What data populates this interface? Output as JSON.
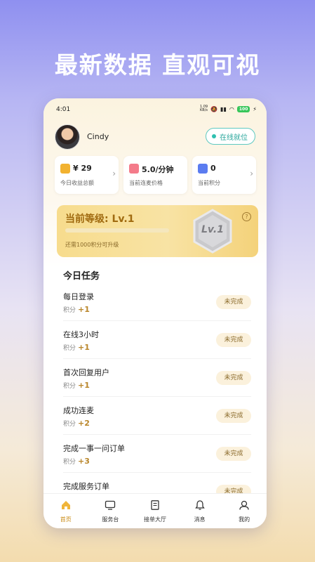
{
  "headline": "最新数据 直观可视",
  "status_bar": {
    "time": "4:01",
    "speed_value": "1.09",
    "speed_unit": "KB/s",
    "battery": "100"
  },
  "profile": {
    "name": "Cindy",
    "status": "在线就位"
  },
  "stats": [
    {
      "value": "¥ 29",
      "label": "今日收益总额",
      "icon": "money-bag-icon",
      "color": "#f2b230"
    },
    {
      "value": "5.0/分钟",
      "label": "当前连麦价格",
      "icon": "heart-hands-icon",
      "color": "#f47b8a"
    },
    {
      "value": "0",
      "label": "当前积分",
      "icon": "coins-stack-icon",
      "color": "#5b7cf0"
    }
  ],
  "level": {
    "title": "当前等级: Lv.1",
    "badge": "Lv.1",
    "hint": "还需1000积分可升级",
    "progress": 0
  },
  "tasks_title": "今日任务",
  "tasks": [
    {
      "name": "每日登录",
      "points_label": "积分",
      "points": "+1",
      "status": "未完成"
    },
    {
      "name": "在线3小时",
      "points_label": "积分",
      "points": "+1",
      "status": "未完成"
    },
    {
      "name": "首次回复用户",
      "points_label": "积分",
      "points": "+1",
      "status": "未完成"
    },
    {
      "name": "成功连麦",
      "points_label": "积分",
      "points": "+2",
      "status": "未完成"
    },
    {
      "name": "完成一事一问订单",
      "points_label": "积分",
      "points": "+3",
      "status": "未完成"
    },
    {
      "name": "完成服务订单",
      "points_label": "",
      "points": "",
      "status": "未完成"
    }
  ],
  "tabs": [
    {
      "label": "首页",
      "icon": "home-icon",
      "active": true
    },
    {
      "label": "服务台",
      "icon": "monitor-icon",
      "active": false
    },
    {
      "label": "接单大厅",
      "icon": "document-icon",
      "active": false
    },
    {
      "label": "消息",
      "icon": "bell-icon",
      "active": false
    },
    {
      "label": "我的",
      "icon": "user-icon",
      "active": false
    }
  ],
  "colors": {
    "accent": "#c98a12",
    "online": "#2aa79c"
  }
}
